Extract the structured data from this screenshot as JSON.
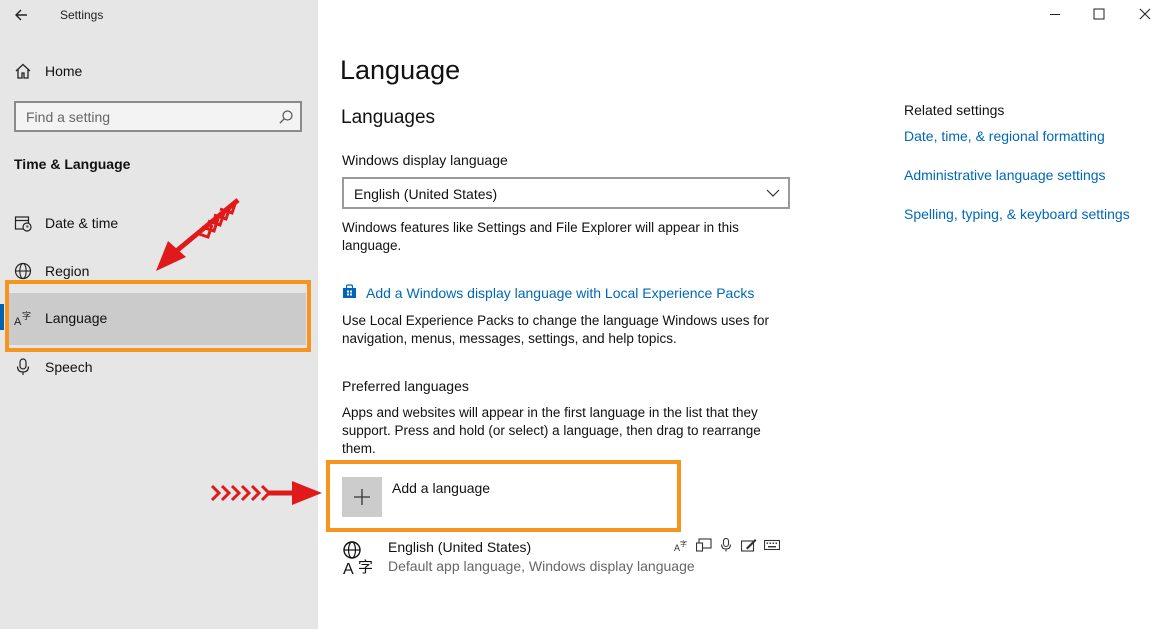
{
  "window": {
    "title": "Settings"
  },
  "sidebar": {
    "home_label": "Home",
    "search_placeholder": "Find a setting",
    "section_title": "Time & Language",
    "items": [
      {
        "label": "Date & time",
        "icon": "calendar-icon"
      },
      {
        "label": "Region",
        "icon": "globe-icon"
      },
      {
        "label": "Language",
        "icon": "language-icon",
        "selected": true
      },
      {
        "label": "Speech",
        "icon": "microphone-icon"
      }
    ]
  },
  "main": {
    "title": "Language",
    "languages_heading": "Languages",
    "display_language_label": "Windows display language",
    "display_language_value": "English (United States)",
    "display_language_desc": "Windows features like Settings and File Explorer will appear in this language.",
    "lxp_link": "Add a Windows display language with Local Experience Packs",
    "lxp_desc": "Use Local Experience Packs to change the language Windows uses for navigation, menus, messages, settings, and help topics.",
    "preferred_label": "Preferred languages",
    "preferred_desc": "Apps and websites will appear in the first language in the list that they support. Press and hold (or select) a language, then drag to rearrange them.",
    "add_language_label": "Add a language",
    "installed_language": {
      "name": "English (United States)",
      "detail": "Default app language, Windows display language",
      "features": [
        "language-pack-icon",
        "text-to-speech-icon",
        "speech-recognition-icon",
        "handwriting-icon",
        "keyboard-icon"
      ]
    }
  },
  "related": {
    "heading": "Related settings",
    "links": [
      "Date, time, & regional formatting",
      "Administrative language settings",
      "Spelling, typing, & keyboard settings"
    ]
  },
  "colors": {
    "accent": "#0067b8",
    "highlight": "#f7941d",
    "arrow": "#e0191b",
    "sidebar_bg": "#e6e6e6"
  }
}
